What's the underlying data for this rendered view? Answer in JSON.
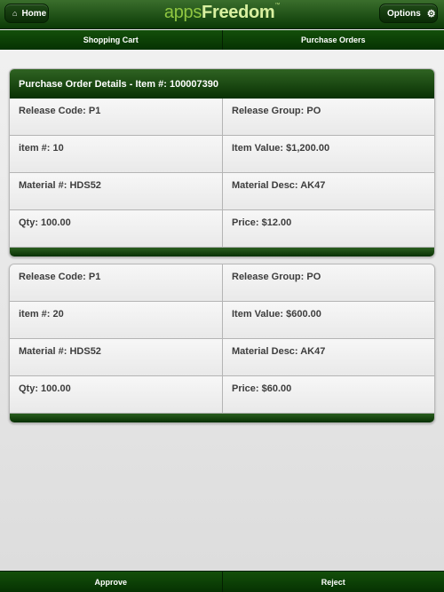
{
  "header": {
    "home_label": "Home",
    "home_icon": "home-icon",
    "logo_part1": "apps",
    "logo_part2": "Freedom",
    "logo_tm": "™",
    "options_label": "Options",
    "options_icon": "gear-icon"
  },
  "tabs": [
    {
      "label": "Shopping Cart"
    },
    {
      "label": "Purchase Orders"
    }
  ],
  "details_title": "Purchase Order Details - Item #: 100007390",
  "items": [
    {
      "release_code": "Release Code: P1",
      "release_group": "Release Group: PO",
      "item_no": "item #: 10",
      "item_value": "Item Value: $1,200.00",
      "material_no": "Material #: HDS52",
      "material_desc": "Material Desc: AK47",
      "qty": "Qty: 100.00",
      "price": "Price: $12.00"
    },
    {
      "release_code": "Release Code: P1",
      "release_group": "Release Group: PO",
      "item_no": "item #: 20",
      "item_value": "Item Value: $600.00",
      "material_no": "Material #: HDS52",
      "material_desc": "Material Desc: AK47",
      "qty": "Qty: 100.00",
      "price": "Price: $60.00"
    }
  ],
  "footer": {
    "approve_label": "Approve",
    "reject_label": "Reject"
  },
  "colors": {
    "header_green": "#0b3a06",
    "logo_light_green": "#8fc641",
    "background": "#e6e6e6"
  }
}
